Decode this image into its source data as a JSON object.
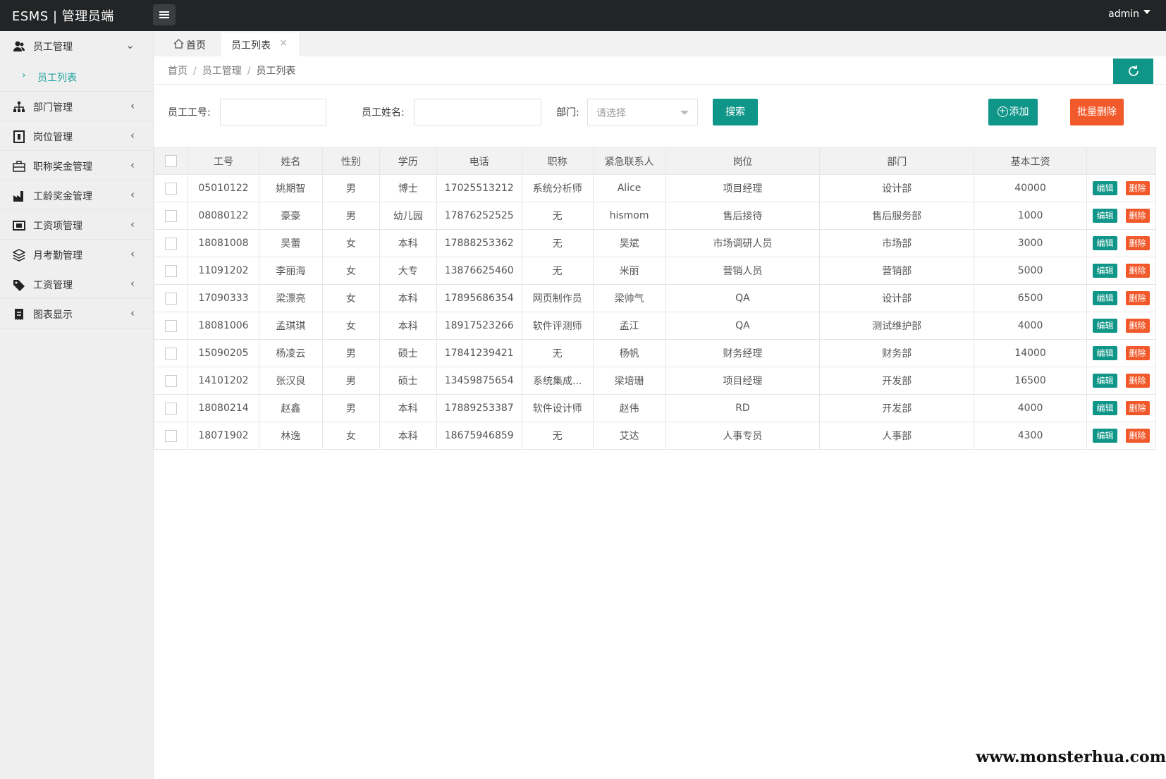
{
  "app": {
    "brand": "ESMS | 管理员端",
    "user": "admin"
  },
  "sidebar": {
    "items": [
      {
        "label": "员工管理",
        "icon": "users-icon",
        "expanded": true
      },
      {
        "label": "部门管理",
        "icon": "org-chart-icon"
      },
      {
        "label": "岗位管理",
        "icon": "badge-icon"
      },
      {
        "label": "职称奖金管理",
        "icon": "briefcase-icon"
      },
      {
        "label": "工龄奖金管理",
        "icon": "factory-icon"
      },
      {
        "label": "工资项管理",
        "icon": "money-icon"
      },
      {
        "label": "月考勤管理",
        "icon": "layers-icon"
      },
      {
        "label": "工资管理",
        "icon": "tag-icon"
      },
      {
        "label": "图表显示",
        "icon": "receipt-icon"
      }
    ],
    "sub_item": "员工列表"
  },
  "tabs": {
    "home": "首页",
    "active": "员工列表"
  },
  "breadcrumb": {
    "home": "首页",
    "section": "员工管理",
    "current": "员工列表"
  },
  "search": {
    "emp_no_label": "员工工号:",
    "emp_name_label": "员工姓名:",
    "dept_label": "部门:",
    "dept_placeholder": "请选择",
    "search_button": "搜索",
    "add_button": "添加",
    "batch_delete_button": "批量删除"
  },
  "table": {
    "headers": [
      "工号",
      "姓名",
      "性别",
      "学历",
      "电话",
      "职称",
      "紧急联系人",
      "岗位",
      "部门",
      "基本工资"
    ],
    "edit_label": "编辑",
    "delete_label": "删除",
    "rows": [
      [
        "05010122",
        "姚期智",
        "男",
        "博士",
        "17025513212",
        "系统分析师",
        "Alice",
        "项目经理",
        "设计部",
        "40000"
      ],
      [
        "08080122",
        "豪豪",
        "男",
        "幼儿园",
        "17876252525",
        "无",
        "hismom",
        "售后接待",
        "售后服务部",
        "1000"
      ],
      [
        "18081008",
        "吴蕾",
        "女",
        "本科",
        "17888253362",
        "无",
        "吴斌",
        "市场调研人员",
        "市场部",
        "3000"
      ],
      [
        "11091202",
        "李丽海",
        "女",
        "大专",
        "13876625460",
        "无",
        "米丽",
        "营销人员",
        "营销部",
        "5000"
      ],
      [
        "17090333",
        "梁漂亮",
        "女",
        "本科",
        "17895686354",
        "网页制作员",
        "梁帅气",
        "QA",
        "设计部",
        "6500"
      ],
      [
        "18081006",
        "孟琪琪",
        "女",
        "本科",
        "18917523266",
        "软件评测师",
        "孟江",
        "QA",
        "测试维护部",
        "4000"
      ],
      [
        "15090205",
        "杨凌云",
        "男",
        "硕士",
        "17841239421",
        "无",
        "杨帆",
        "财务经理",
        "财务部",
        "14000"
      ],
      [
        "14101202",
        "张汉良",
        "男",
        "硕士",
        "13459875654",
        "系统集成...",
        "梁培珊",
        "项目经理",
        "开发部",
        "16500"
      ],
      [
        "18080214",
        "赵鑫",
        "男",
        "本科",
        "17889253387",
        "软件设计师",
        "赵伟",
        "RD",
        "开发部",
        "4000"
      ],
      [
        "18071902",
        "林逸",
        "女",
        "本科",
        "18675946859",
        "无",
        "艾达",
        "人事专员",
        "人事部",
        "4300"
      ]
    ]
  },
  "watermark": "www.monsterhua.com",
  "colors": {
    "primary": "#0f9688",
    "danger": "#f1592a",
    "topbar": "#222426",
    "sidebar": "#efefef",
    "active_link": "#1fa2a0"
  }
}
